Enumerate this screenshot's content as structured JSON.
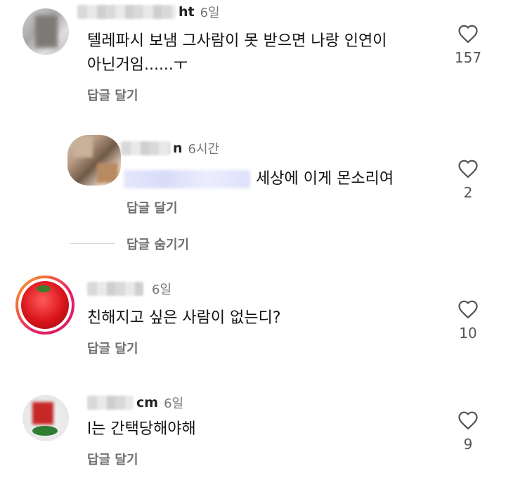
{
  "comments": [
    {
      "username_visible": "ht",
      "time": "6일",
      "text_line1": "텔레파시 보냄 그사람이 못 받으면 나랑 인연이",
      "text_line2": "아닌거임......ㅜ",
      "reply_label": "답글 달기",
      "likes": "157"
    },
    {
      "username_visible": "n",
      "time": "6시간",
      "text": "세상에 이게 몬소리여",
      "reply_label": "답글 달기",
      "likes": "2"
    },
    {
      "username_visible": "",
      "time": "6일",
      "text": "친해지고 싶은 사람이 없는디?",
      "reply_label": "답글 달기",
      "likes": "10"
    },
    {
      "username_visible": "cm",
      "time": "6일",
      "text": "l는 간택당해야해",
      "reply_label": "답글 달기",
      "likes": "9"
    }
  ],
  "hide_replies_label": "답글 숨기기",
  "colors": {
    "story_ring_start": "#f9a825",
    "story_ring_end": "#d81b60",
    "icon": "#555555"
  },
  "icons": {
    "like": "heart-outline-icon"
  }
}
